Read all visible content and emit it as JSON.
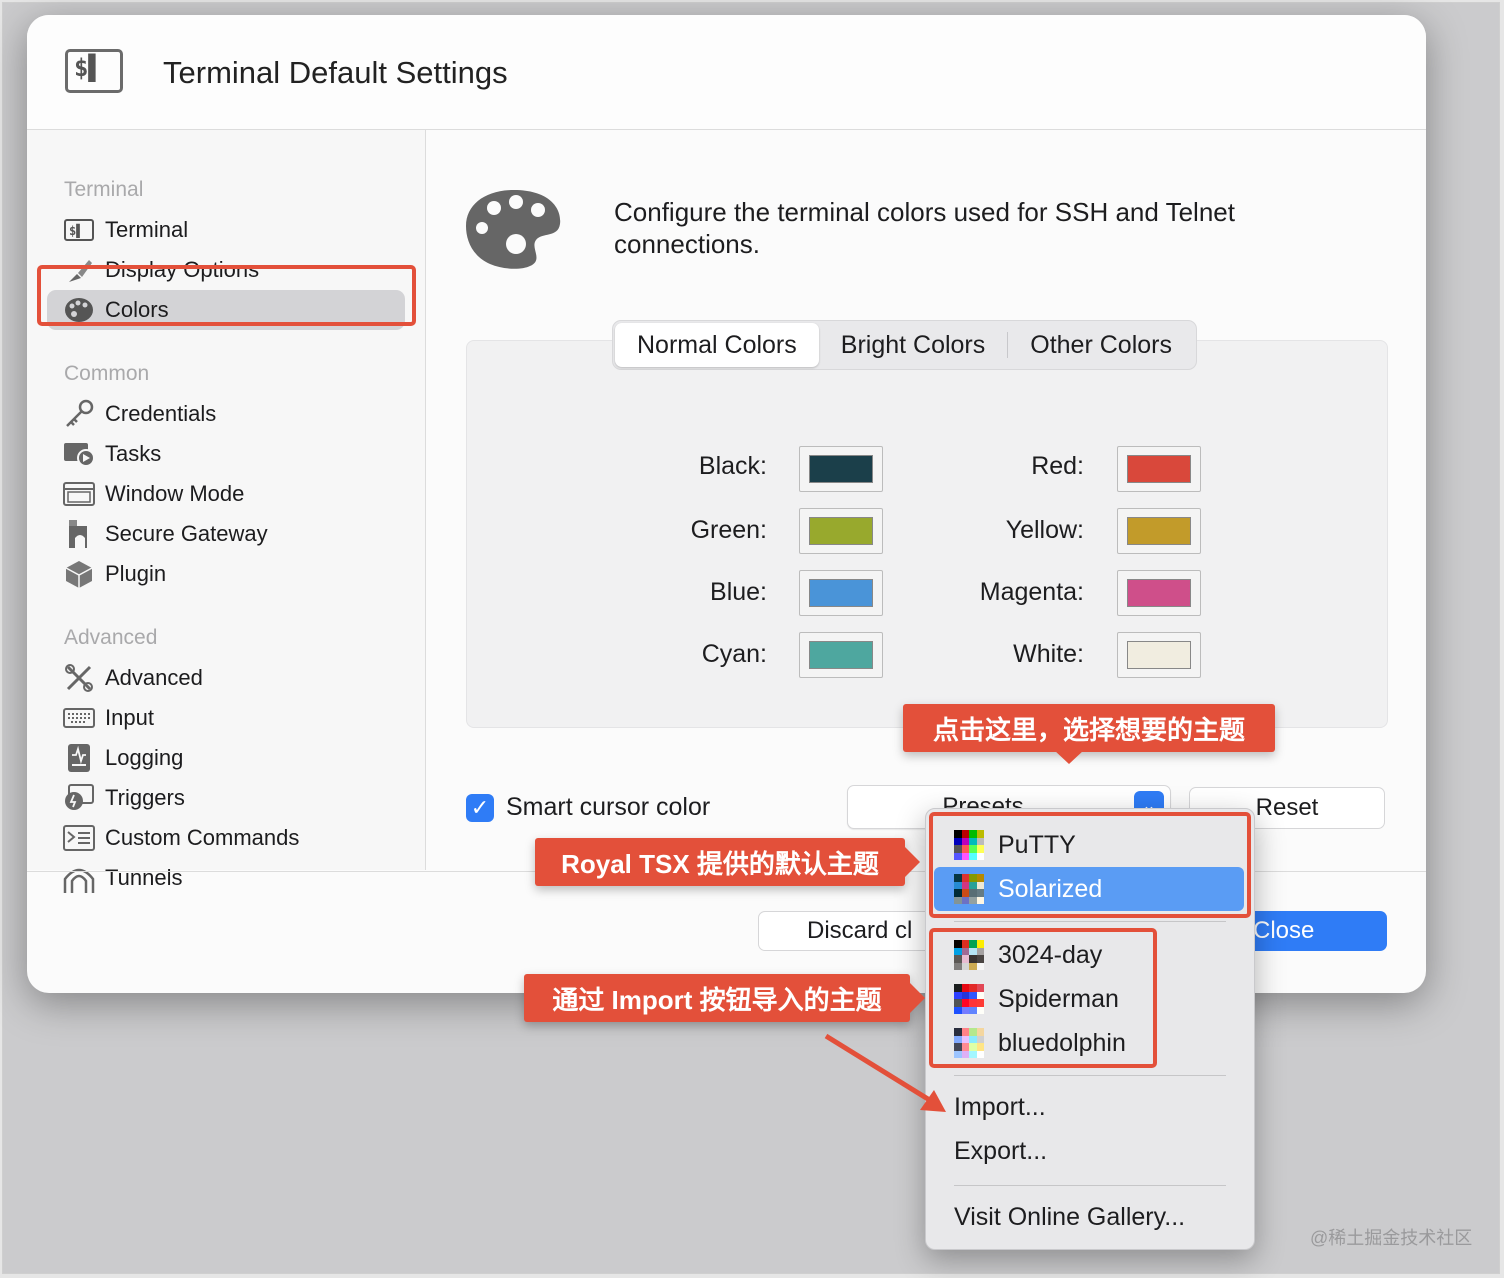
{
  "window": {
    "title": "Terminal Default Settings",
    "app_icon": "terminal-dollar-icon",
    "app_icon_glyph": "$▌"
  },
  "sidebar": {
    "sections": [
      {
        "heading": "Terminal",
        "items": [
          {
            "label": "Terminal",
            "icon": "terminal-icon"
          },
          {
            "label": "Display Options",
            "icon": "brush-icon"
          },
          {
            "label": "Colors",
            "icon": "palette-icon",
            "selected": true
          }
        ]
      },
      {
        "heading": "Common",
        "items": [
          {
            "label": "Credentials",
            "icon": "key-icon"
          },
          {
            "label": "Tasks",
            "icon": "tasks-icon"
          },
          {
            "label": "Window Mode",
            "icon": "window-icon"
          },
          {
            "label": "Secure Gateway",
            "icon": "gateway-icon"
          },
          {
            "label": "Plugin",
            "icon": "plugin-icon"
          }
        ]
      },
      {
        "heading": "Advanced",
        "items": [
          {
            "label": "Advanced",
            "icon": "tools-icon"
          },
          {
            "label": "Input",
            "icon": "keyboard-icon"
          },
          {
            "label": "Logging",
            "icon": "log-icon"
          },
          {
            "label": "Triggers",
            "icon": "trigger-icon"
          },
          {
            "label": "Custom Commands",
            "icon": "command-icon"
          },
          {
            "label": "Tunnels",
            "icon": "tunnel-icon"
          }
        ]
      }
    ]
  },
  "main": {
    "description": "Configure the terminal colors used for SSH and Telnet connections.",
    "tabs": [
      {
        "label": "Normal Colors",
        "active": true
      },
      {
        "label": "Bright Colors",
        "active": false
      },
      {
        "label": "Other Colors",
        "active": false
      }
    ],
    "colors": [
      {
        "label": "Black:",
        "hex": "#1b3f4a"
      },
      {
        "label": "Red:",
        "hex": "#d9483b"
      },
      {
        "label": "Green:",
        "hex": "#98a92d"
      },
      {
        "label": "Yellow:",
        "hex": "#c29b2a"
      },
      {
        "label": "Blue:",
        "hex": "#4a94d8"
      },
      {
        "label": "Magenta:",
        "hex": "#cf4f8a"
      },
      {
        "label": "Cyan:",
        "hex": "#4ea79f"
      },
      {
        "label": "White:",
        "hex": "#f1ede0"
      }
    ],
    "smart_cursor": {
      "label": "Smart cursor color",
      "checked": true
    },
    "presets_label": "Presets...",
    "reset_label": "Reset"
  },
  "footer": {
    "discard_label": "Discard cl",
    "close_label": "Close"
  },
  "presets_menu": {
    "builtin": [
      {
        "label": "PuTTY",
        "highlighted": false
      },
      {
        "label": "Solarized",
        "highlighted": true
      }
    ],
    "imported": [
      {
        "label": "3024-day"
      },
      {
        "label": "Spiderman"
      },
      {
        "label": "bluedolphin"
      }
    ],
    "import_label": "Import...",
    "export_label": "Export...",
    "gallery_label": "Visit Online Gallery..."
  },
  "annotations": {
    "presets_hint": "点击这里，选择想要的主题",
    "builtin_hint": "Royal TSX 提供的默认主题",
    "import_hint": "通过 Import 按钮导入的主题",
    "accent": "#e3503a"
  },
  "watermark": "@稀土掘金技术社区"
}
